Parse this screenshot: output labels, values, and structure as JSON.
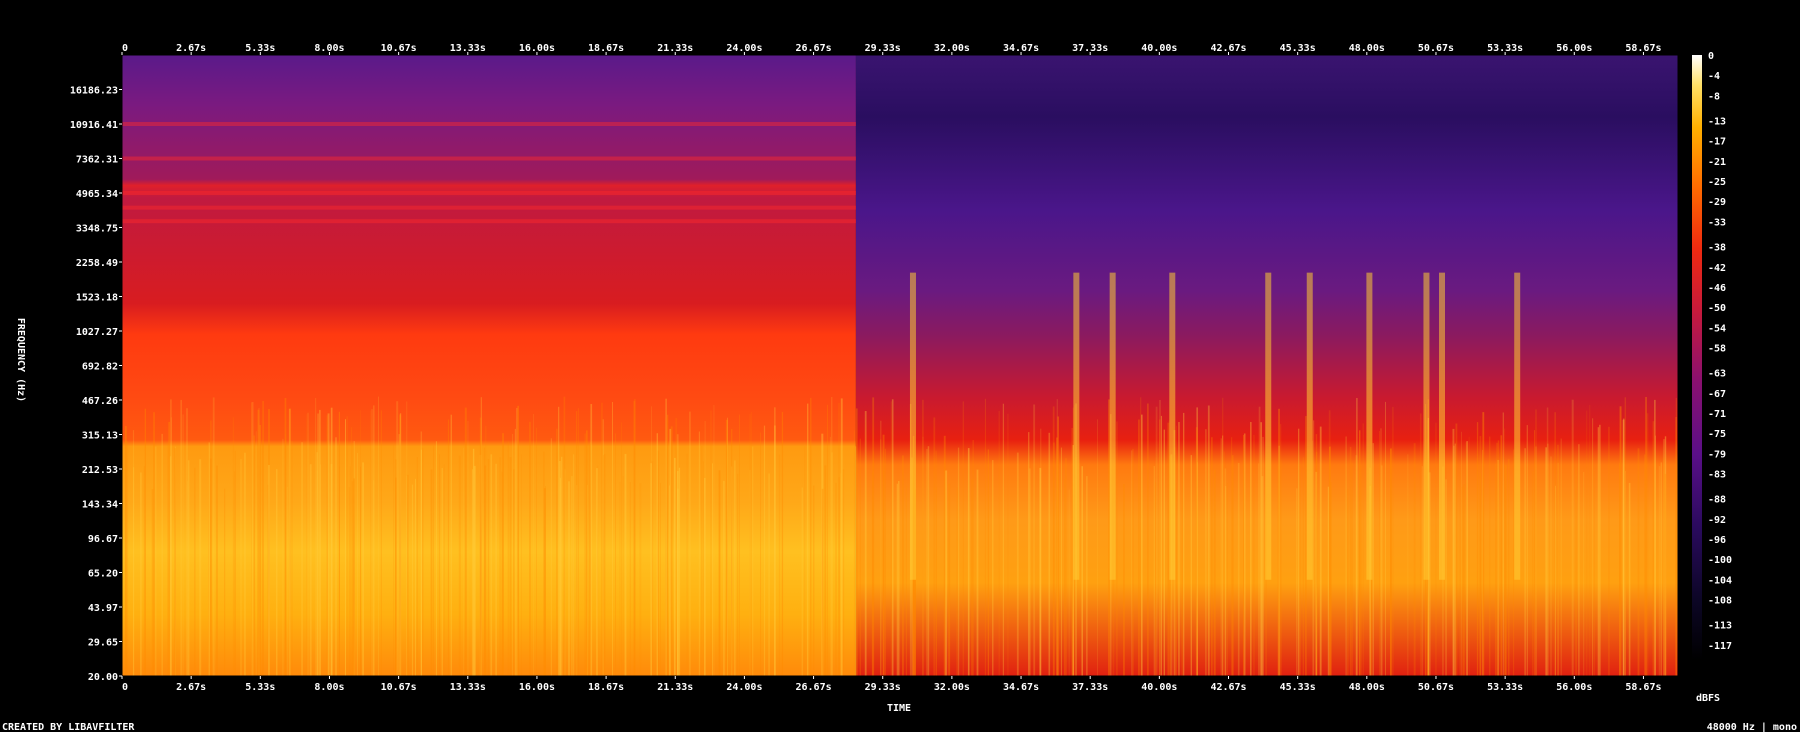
{
  "chart_data": {
    "type": "heatmap",
    "title": "",
    "xlabel": "TIME",
    "ylabel": "FREQUENCY (Hz)",
    "x_ticks": [
      "0",
      "2.67s",
      "5.33s",
      "8.00s",
      "10.67s",
      "13.33s",
      "16.00s",
      "18.67s",
      "21.33s",
      "24.00s",
      "26.67s",
      "29.33s",
      "32.00s",
      "34.67s",
      "37.33s",
      "40.00s",
      "42.67s",
      "45.33s",
      "48.00s",
      "50.67s",
      "53.33s",
      "56.00s",
      "58.67s"
    ],
    "y_ticks": [
      "16186.23",
      "10916.41",
      "7362.31",
      "4965.34",
      "3348.75",
      "2258.49",
      "1523.18",
      "1027.27",
      "692.82",
      "467.26",
      "315.13",
      "212.53",
      "143.34",
      "96.67",
      "65.20",
      "43.97",
      "29.65",
      "20.00"
    ],
    "y_scale": "log",
    "xlim": [
      0,
      60
    ],
    "ylim": [
      20,
      24000
    ],
    "colorbar": {
      "label": "dBFS",
      "ticks": [
        "0",
        "-4",
        "-8",
        "-13",
        "-17",
        "-21",
        "-25",
        "-29",
        "-33",
        "-38",
        "-42",
        "-46",
        "-50",
        "-54",
        "-58",
        "-63",
        "-67",
        "-71",
        "-75",
        "-79",
        "-83",
        "-88",
        "-92",
        "-96",
        "-100",
        "-104",
        "-108",
        "-113",
        "-117"
      ],
      "range": [
        -120,
        0
      ]
    },
    "description_segments": [
      {
        "time": [
          0,
          28.3
        ],
        "level_low_freq_dbfs": -25,
        "level_mid_freq_dbfs": -45,
        "level_high_freq_dbfs": -70
      },
      {
        "time": [
          28.3,
          60
        ],
        "level_low_freq_dbfs": -35,
        "level_mid_freq_dbfs": -70,
        "level_high_freq_dbfs": -90
      }
    ]
  },
  "footer": {
    "credit": "CREATED BY LIBAVFILTER",
    "format": "48000 Hz | mono"
  },
  "colors": {
    "background": "#000000",
    "text": "#ffffff"
  }
}
